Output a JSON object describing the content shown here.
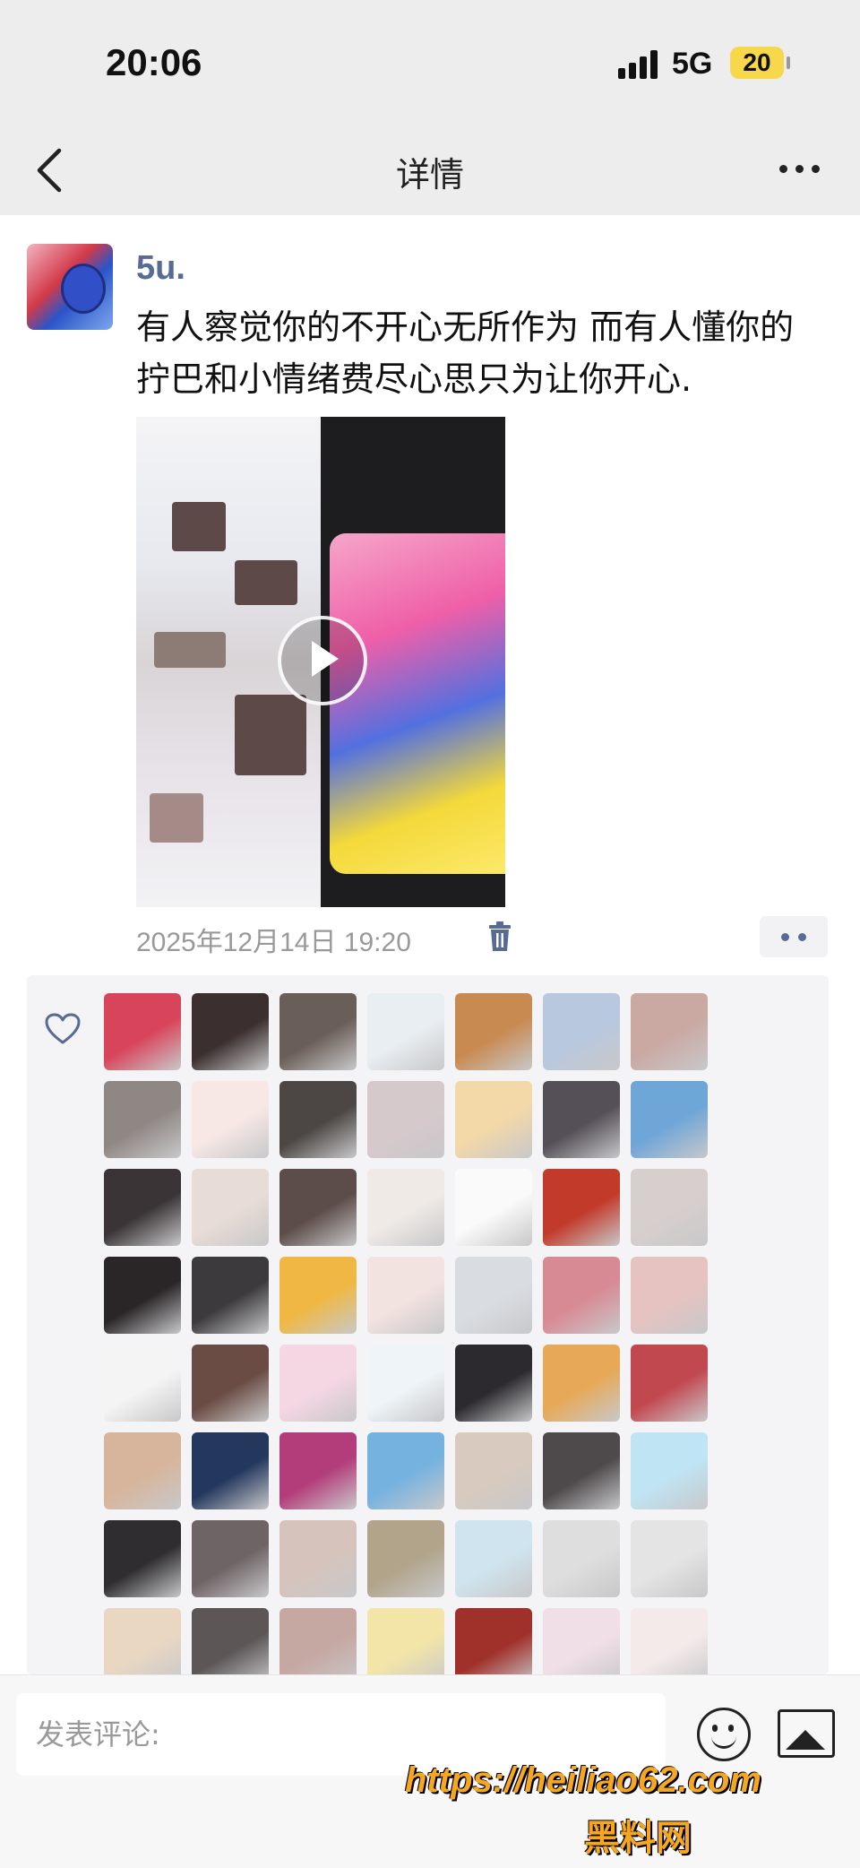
{
  "status": {
    "time": "20:06",
    "network": "5G",
    "battery": "20"
  },
  "nav": {
    "title": "详情"
  },
  "post": {
    "username": "5u.",
    "text": "有人察觉你的不开心无所作为 而有人懂你的拧巴和小情绪费尽心思只为让你开心.",
    "time": "2025年12月14日 19:20"
  },
  "comment": {
    "placeholder": "发表评论:"
  },
  "watermark": {
    "url": "https://heiliao62.com",
    "site": "黑料网"
  },
  "colors": {
    "link": "#576b95",
    "watermark": "#f5a623"
  },
  "likes": {
    "avatar_colors": [
      "#d8455a",
      "#3b2f2f",
      "#6a5e58",
      "#e9eef2",
      "#c98a52",
      "#b8c8df",
      "#caa9a3",
      "#8f8784",
      "#f7e8e5",
      "#4c4744",
      "#d6c9cc",
      "#f3d8a8",
      "#555058",
      "#6fa6d8",
      "#3a3436",
      "#e8dcd6",
      "#5d4d4a",
      "#efeae6",
      "#fafafa",
      "#c23a2a",
      "#d7cfcd",
      "#2a2628",
      "#3c3a3c",
      "#f0b843",
      "#f2e2e0",
      "#d9dde2",
      "#d88a94",
      "#e6c3c0",
      "#f4f4f4",
      "#6a4c44",
      "#f5d7e4",
      "#eef4f8",
      "#2c2a2e",
      "#e7a958",
      "#c24850",
      "#d7b59c",
      "#24385e",
      "#b33d7a",
      "#76b2e0",
      "#d8cabe",
      "#4e4a4c",
      "#bfe4f4",
      "#2f2d30",
      "#6e6466",
      "#d6c4bc",
      "#b1a48a",
      "#cfe4ee",
      "#dedede",
      "#e4e4e4",
      "#e9d7c2",
      "#5c5657",
      "#c6a8a2",
      "#f3e5a8",
      "#a0302a",
      "#f0dfe6",
      "#f4eaea"
    ]
  }
}
